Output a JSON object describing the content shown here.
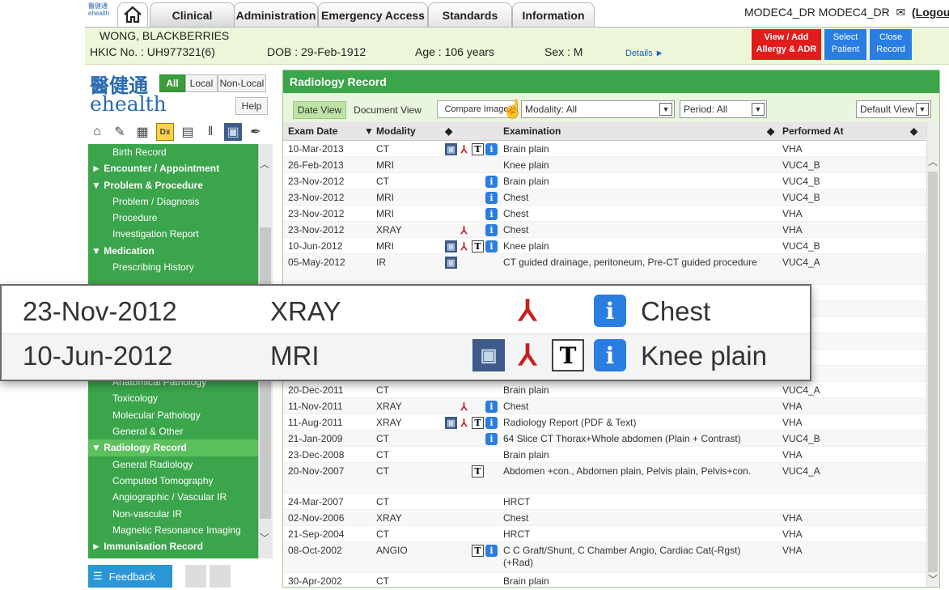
{
  "topnav": {
    "logo_text": "醫健通 ehealth",
    "tabs": [
      "Clinical",
      "Administration",
      "Emergency Access",
      "Standards",
      "Information"
    ],
    "user": "MODEC4_DR MODEC4_DR",
    "logout_label": "(Logout"
  },
  "patient": {
    "name": "WONG, BLACKBERRIES",
    "hkic": "HKIC No. : UH977321(6)",
    "dob": "DOB : 29-Feb-1912",
    "age": "Age : 106 years",
    "sex": "Sex : M",
    "details_label": "Details ►",
    "allergy_btn_l1": "View / Add",
    "allergy_btn_l2": "Allergy & ADR",
    "select_btn_l1": "Select",
    "select_btn_l2": "Patient",
    "close_btn_l1": "Close",
    "close_btn_l2": "Record"
  },
  "left_panel": {
    "logo_cn": "醫健通",
    "logo_en": "ehealth",
    "scope_all": "All",
    "scope_local": "Local",
    "scope_nonlocal": "Non-Local",
    "help_label": "Help",
    "toolbar_icons": [
      "home-icon",
      "edit-note-icon",
      "calendar-icon",
      "dx-icon",
      "printer-icon",
      "lab-tubes-icon",
      "radiology-film-icon",
      "pen-icon"
    ],
    "tree": [
      {
        "label": "Birth Record",
        "level": 1
      },
      {
        "label": "► Encounter / Appointment",
        "level": 0
      },
      {
        "label": "▼ Problem & Procedure",
        "level": 0
      },
      {
        "label": "Problem / Diagnosis",
        "level": 1
      },
      {
        "label": "Procedure",
        "level": 1
      },
      {
        "label": "Investigation Report",
        "level": 1
      },
      {
        "label": "▼ Medication",
        "level": 0
      },
      {
        "label": "Prescribing History",
        "level": 1
      },
      {
        "label": "",
        "level": 1
      },
      {
        "label": "",
        "level": 1
      },
      {
        "label": "",
        "level": 1
      },
      {
        "label": "",
        "level": 1
      },
      {
        "label": "",
        "level": 1
      },
      {
        "label": "",
        "level": 1
      },
      {
        "label": "Anatomical Pathology",
        "level": 1
      },
      {
        "label": "Toxicology",
        "level": 1
      },
      {
        "label": "Molecular Pathology",
        "level": 1
      },
      {
        "label": "General & Other",
        "level": 1
      },
      {
        "label": "▼ Radiology Record",
        "level": 0,
        "active": true
      },
      {
        "label": "General Radiology",
        "level": 1
      },
      {
        "label": "Computed Tomography",
        "level": 1
      },
      {
        "label": "Angiographic / Vascular IR",
        "level": 1
      },
      {
        "label": "Non-vascular IR",
        "level": 1
      },
      {
        "label": "Magnetic Resonance Imaging",
        "level": 1
      },
      {
        "label": "► Immunisation Record",
        "level": 0
      }
    ],
    "feedback_label": "Feedback"
  },
  "main": {
    "title": "Radiology Record",
    "date_view": "Date View",
    "document_view": "Document View",
    "compare_image": "Compare Image",
    "modality_select": "Modality: All",
    "period_select": "Period: All",
    "default_view": "Default View",
    "columns": {
      "exam_date": "Exam Date",
      "modality": "Modality",
      "examination": "Examination",
      "performed_at": "Performed At"
    },
    "rows": [
      {
        "date": "10-Mar-2013",
        "modality": "CT",
        "icons": [
          "img",
          "pdf",
          "txt",
          "info"
        ],
        "exam": "Brain plain",
        "performed": "VHA"
      },
      {
        "date": "26-Feb-2013",
        "modality": "MRI",
        "icons": [],
        "exam": "Knee plain",
        "performed": "VUC4_B"
      },
      {
        "date": "23-Nov-2012",
        "modality": "CT",
        "icons": [
          "info"
        ],
        "exam": "Brain plain",
        "performed": "VUC4_B"
      },
      {
        "date": "23-Nov-2012",
        "modality": "MRI",
        "icons": [
          "info"
        ],
        "exam": "Chest",
        "performed": "VUC4_B"
      },
      {
        "date": "23-Nov-2012",
        "modality": "MRI",
        "icons": [
          "info"
        ],
        "exam": "Chest",
        "performed": "VHA"
      },
      {
        "date": "23-Nov-2012",
        "modality": "XRAY",
        "icons": [
          "pdf",
          "info"
        ],
        "exam": "Chest",
        "performed": "VHA"
      },
      {
        "date": "10-Jun-2012",
        "modality": "MRI",
        "icons": [
          "img",
          "pdf",
          "txt",
          "info"
        ],
        "exam": "Knee plain",
        "performed": "VUC4_B"
      },
      {
        "date": "05-May-2012",
        "modality": "IR",
        "icons": [
          "img"
        ],
        "exam": "CT guided drainage, peritoneum, Pre-CT guided procedure",
        "performed": "VUC4_A"
      },
      {
        "date": "",
        "modality": "",
        "icons": [],
        "exam": "",
        "performed": ""
      },
      {
        "date": "",
        "modality": "",
        "icons": [],
        "exam": "",
        "performed": "B"
      },
      {
        "date": "",
        "modality": "",
        "icons": [],
        "exam": "",
        "performed": ""
      },
      {
        "date": "",
        "modality": "",
        "icons": [],
        "exam": "",
        "performed": ""
      },
      {
        "date": "",
        "modality": "",
        "icons": [],
        "exam": "",
        "performed": ""
      },
      {
        "date": "",
        "modality": "",
        "icons": [],
        "exam": "",
        "performed": ""
      },
      {
        "date": "20-Dec-2011",
        "modality": "CT",
        "icons": [],
        "exam": "Brain plain",
        "performed": "VUC4_A"
      },
      {
        "date": "11-Nov-2011",
        "modality": "XRAY",
        "icons": [
          "pdf",
          "info"
        ],
        "exam": "Chest",
        "performed": "VHA"
      },
      {
        "date": "11-Aug-2011",
        "modality": "XRAY",
        "icons": [
          "img",
          "pdf",
          "txt",
          "info"
        ],
        "exam": "Radiology Report (PDF & Text)",
        "performed": "VHA"
      },
      {
        "date": "21-Jan-2009",
        "modality": "CT",
        "icons": [
          "info"
        ],
        "exam": "64 Slice CT Thorax+Whole abdomen (Plain + Contrast)",
        "performed": "VUC4_B"
      },
      {
        "date": "23-Dec-2008",
        "modality": "CT",
        "icons": [],
        "exam": "Brain plain",
        "performed": "VHA"
      },
      {
        "date": "20-Nov-2007",
        "modality": "CT",
        "icons": [
          "txt"
        ],
        "exam": "Abdomen +con., Abdomen plain, Pelvis plain, Pelvis+con.",
        "performed": "VUC4_A"
      },
      {
        "date": "24-Mar-2007",
        "modality": "CT",
        "icons": [],
        "exam": "HRCT",
        "performed": ""
      },
      {
        "date": "02-Nov-2006",
        "modality": "XRAY",
        "icons": [],
        "exam": "Chest",
        "performed": "VHA"
      },
      {
        "date": "21-Sep-2004",
        "modality": "CT",
        "icons": [],
        "exam": "HRCT",
        "performed": "VHA"
      },
      {
        "date": "08-Oct-2002",
        "modality": "ANGIO",
        "icons": [
          "txt",
          "info"
        ],
        "exam": "C C Graft/Shunt, C Chamber Angio, Cardiac Cat(-Rgst) (+Rad)",
        "performed": "VHA"
      },
      {
        "date": "30-Apr-2002",
        "modality": "CT",
        "icons": [],
        "exam": "Brain plain",
        "performed": ""
      }
    ]
  },
  "magnifier": {
    "rows": [
      {
        "date": "23-Nov-2012",
        "modality": "XRAY",
        "icons": [
          "pdf",
          "info"
        ],
        "exam": "Chest"
      },
      {
        "date": "10-Jun-2012",
        "modality": "MRI",
        "icons": [
          "img",
          "pdf",
          "txt",
          "info"
        ],
        "exam": "Knee plain"
      }
    ]
  },
  "icon_glyphs": {
    "img": "▣",
    "pdf": "⅄",
    "txt": "T",
    "info": "i"
  }
}
